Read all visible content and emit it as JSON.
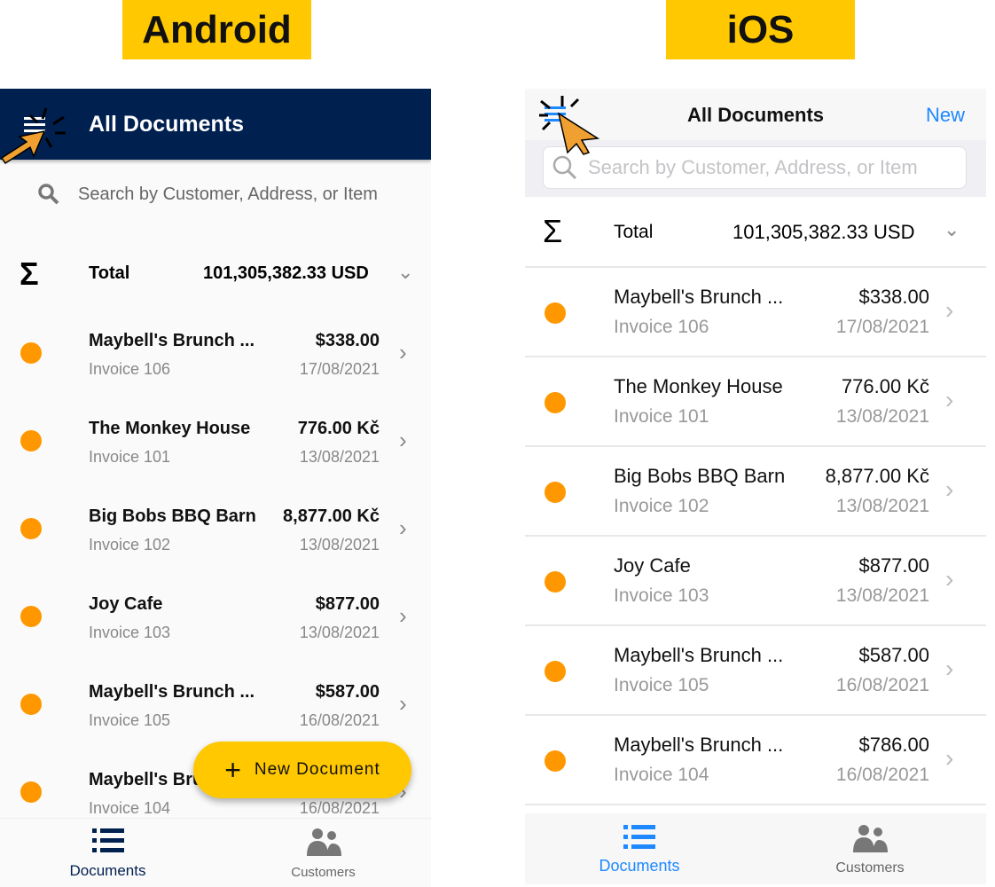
{
  "labels": {
    "android": "Android",
    "ios": "iOS"
  },
  "colors": {
    "android_header": "#002050",
    "accent_yellow": "#ffc800",
    "status_dot": "#ff9800",
    "ios_blue": "#1e88ff"
  },
  "android": {
    "title": "All Documents",
    "search_placeholder": "Search by Customer, Address, or Item",
    "total": {
      "symbol": "Σ",
      "label": "Total",
      "value": "101,305,382.33 USD"
    },
    "documents": [
      {
        "name": "Maybell's Brunch ...",
        "invoice": "Invoice 106",
        "amount": "$338.00",
        "date": "17/08/2021"
      },
      {
        "name": "The Monkey House",
        "invoice": "Invoice 101",
        "amount": "776.00 Kč",
        "date": "13/08/2021"
      },
      {
        "name": "Big Bobs BBQ Barn",
        "invoice": "Invoice 102",
        "amount": "8,877.00 Kč",
        "date": "13/08/2021"
      },
      {
        "name": "Joy Cafe",
        "invoice": "Invoice 103",
        "amount": "$877.00",
        "date": "13/08/2021"
      },
      {
        "name": "Maybell's Brunch ...",
        "invoice": "Invoice 105",
        "amount": "$587.00",
        "date": "16/08/2021"
      },
      {
        "name": "Maybell's Brunch ...",
        "invoice": "Invoice 104",
        "amount": "",
        "date": "16/08/2021"
      }
    ],
    "fab": {
      "icon": "+",
      "label": "New Document"
    },
    "tabs": [
      {
        "label": "Documents",
        "icon": "list-icon"
      },
      {
        "label": "Customers",
        "icon": "people-icon"
      }
    ]
  },
  "ios": {
    "title": "All Documents",
    "new_label": "New",
    "search_placeholder": "Search by Customer, Address, or Item",
    "total": {
      "symbol": "Σ",
      "label": "Total",
      "value": "101,305,382.33 USD"
    },
    "documents": [
      {
        "name": "Maybell's Brunch ...",
        "invoice": "Invoice 106",
        "amount": "$338.00",
        "date": "17/08/2021"
      },
      {
        "name": "The Monkey House",
        "invoice": "Invoice 101",
        "amount": "776.00 Kč",
        "date": "13/08/2021"
      },
      {
        "name": "Big Bobs BBQ Barn",
        "invoice": "Invoice 102",
        "amount": "8,877.00 Kč",
        "date": "13/08/2021"
      },
      {
        "name": "Joy Cafe",
        "invoice": "Invoice 103",
        "amount": "$877.00",
        "date": "13/08/2021"
      },
      {
        "name": "Maybell's Brunch ...",
        "invoice": "Invoice 105",
        "amount": "$587.00",
        "date": "16/08/2021"
      },
      {
        "name": "Maybell's Brunch ...",
        "invoice": "Invoice 104",
        "amount": "$786.00",
        "date": "16/08/2021"
      }
    ],
    "tabs": [
      {
        "label": "Documents",
        "icon": "list-icon"
      },
      {
        "label": "Customers",
        "icon": "people-icon"
      }
    ]
  }
}
